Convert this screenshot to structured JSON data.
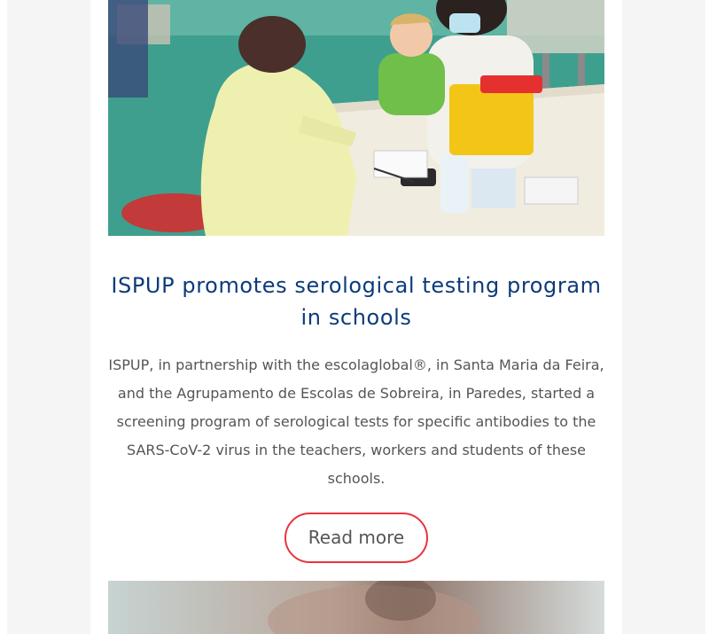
{
  "article": {
    "title": "ISPUP promotes serological testing program in schools",
    "excerpt": "ISPUP, in partnership with the escolaglobal®, in Santa Maria da Feira, and the Agrupamento de Escolas de Sobreira, in Paredes, started a screening program of serological tests for specific antibodies to the SARS-CoV-2 virus in the teachers, workers and students of these schools.",
    "read_more_label": "Read more",
    "image_alt": "Health worker in protective gown performing a test on a child seated with an adult at a school table"
  },
  "next_article": {
    "image_alt": "Blurred photo of a person"
  },
  "colors": {
    "title": "#0d3b7a",
    "body_text": "#555555",
    "button_border": "#e8343f",
    "page_background": "#f5f5f5",
    "card_background": "#ffffff"
  }
}
